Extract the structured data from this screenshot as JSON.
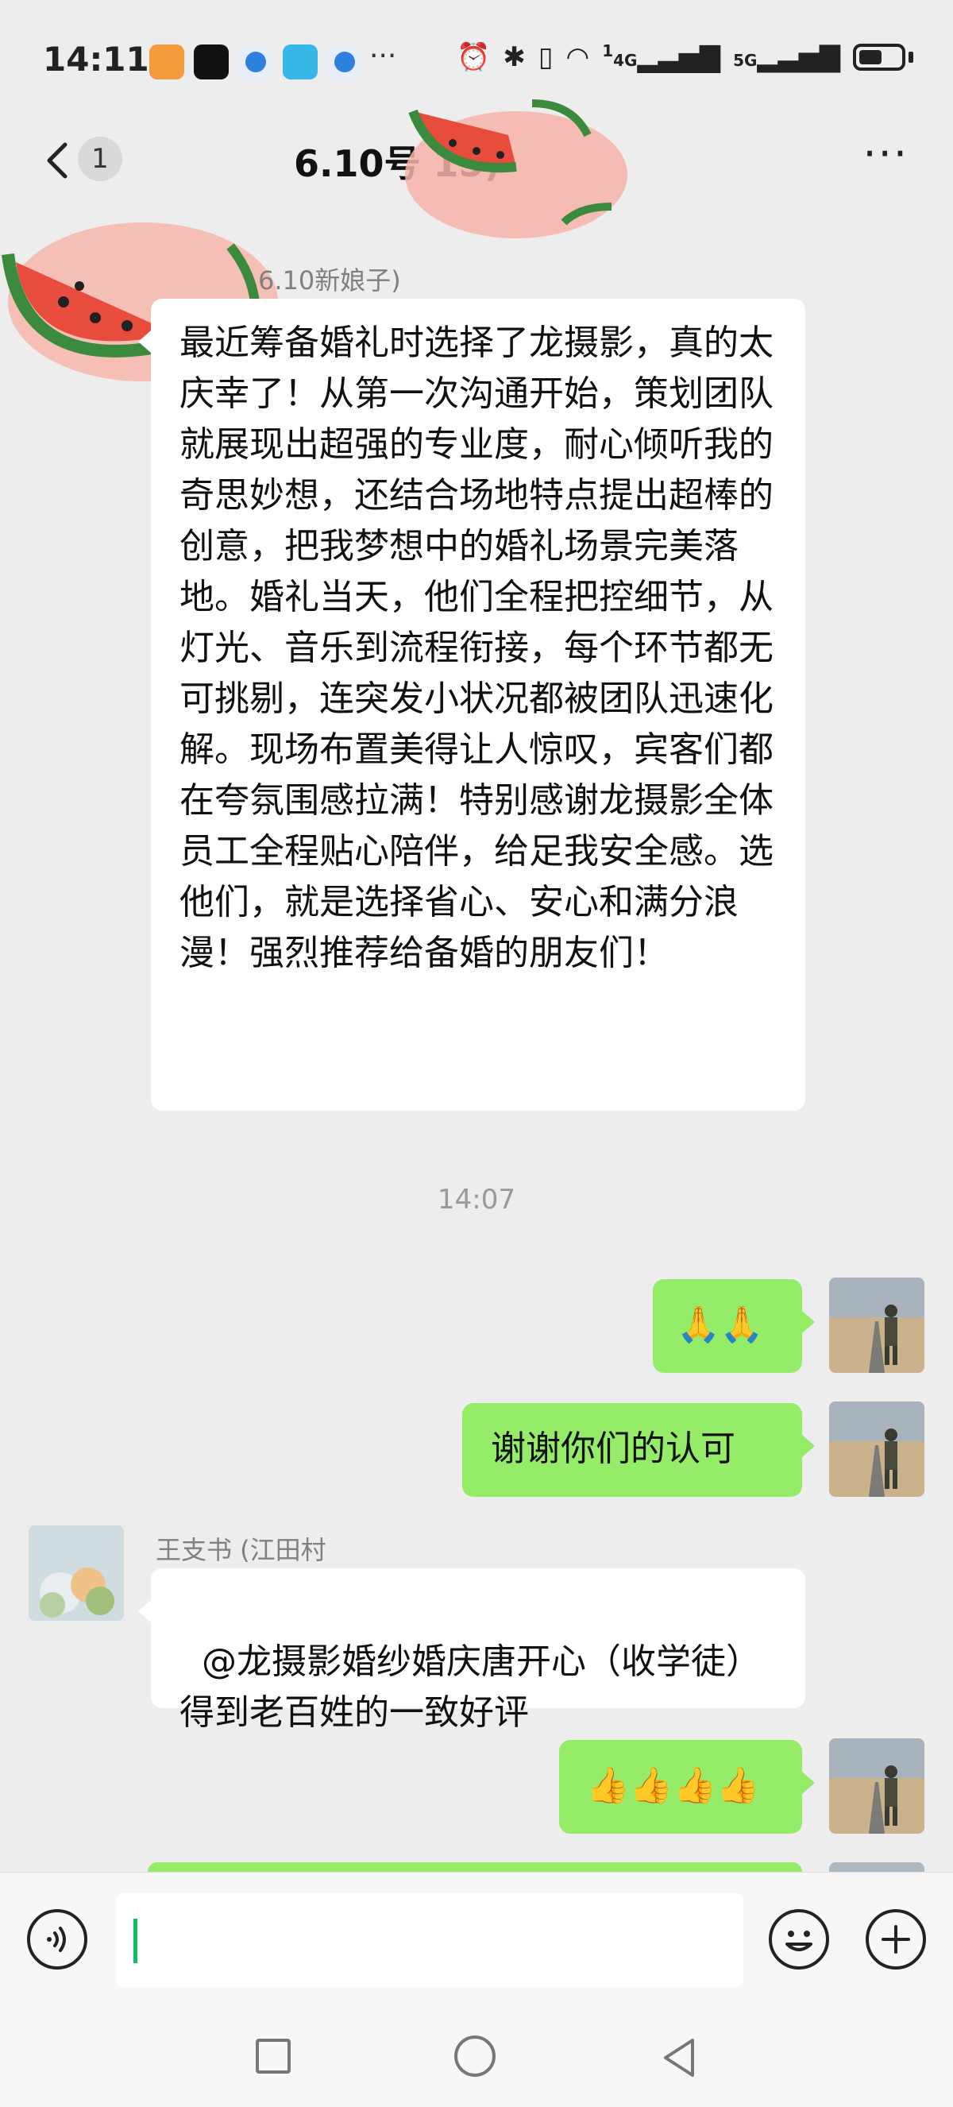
{
  "status_bar": {
    "time": "14:11",
    "overflow": "···",
    "net_4g": "4G",
    "net_5g": "5G",
    "sig_sup": "1"
  },
  "header": {
    "unread_count": "1",
    "title": "6.10号                15)"
  },
  "messages": [
    {
      "side": "left",
      "sender": "6.10新娘子)",
      "text": "最近筹备婚礼时选择了龙摄影，真的太庆幸了！从第一次沟通开始，策划团队就展现出超强的专业度，耐心倾听我的奇思妙想，还结合场地特点提出超棒的创意，把我梦想中的婚礼场景完美落地。婚礼当天，他们全程把控细节，从灯光、音乐到流程衔接，每个环节都无可挑剔，连突发小状况都被团队迅速化解。现场布置美得让人惊叹，宾客们都在夸氛围感拉满！特别感谢龙摄影全体员工全程贴心陪伴，给足我安全感。选他们，就是选择省心、安心和满分浪漫！强烈推荐给备婚的朋友们！"
    },
    {
      "side": "time",
      "text": "14:07"
    },
    {
      "side": "right",
      "text": "🙏🙏"
    },
    {
      "side": "right",
      "text": "谢谢你们的认可"
    },
    {
      "side": "left",
      "sender": "王支书 (江田村",
      "text": "@龙摄影婚纱婚庆唐开心（收学徒）\n得到老百姓的一致好评"
    },
    {
      "side": "right",
      "text": "👍👍👍👍"
    }
  ],
  "colors": {
    "background": "#ededed",
    "bubble_self": "#95ec69",
    "bubble_other": "#ffffff",
    "caret": "#07c160"
  },
  "input_bar": {
    "voice_icon": "voice-icon",
    "emoji_icon": "emoji-icon",
    "plus_icon": "plus-icon"
  }
}
